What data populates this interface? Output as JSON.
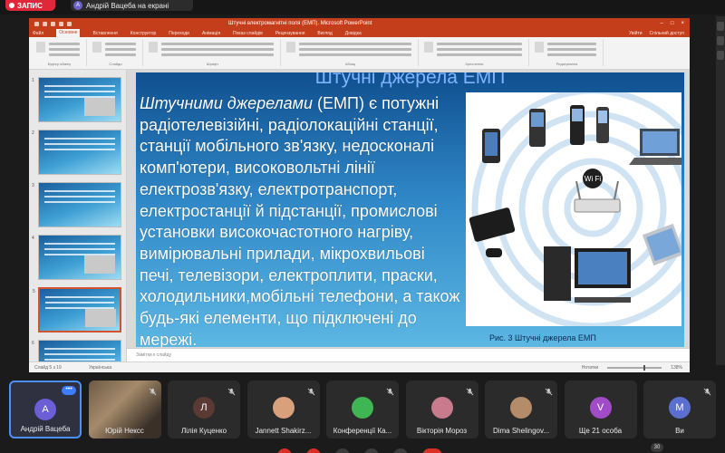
{
  "topbar": {
    "record_label": "ЗАПИС",
    "presenter_initial": "А",
    "presenter_text": "Андрій Вацеба на екрані"
  },
  "ppt": {
    "window_title": "Штучні електромагнітні поля (ЕМП). Microsoft PowerPoint",
    "tabs": [
      "Файл",
      "Основне",
      "Вставлення",
      "Конструктор",
      "Переходи",
      "Анімація",
      "Показ слайдів",
      "Рецензування",
      "Вигляд",
      "Довідка"
    ],
    "active_tab_index": 1,
    "account": "Увійти",
    "share": "Спільний доступ",
    "ribbon_groups": [
      "Буфер обміну",
      "Слайди",
      "Шрифт",
      "Абзац",
      "Креслення",
      "Редагування"
    ],
    "slide_count_text": "Слайд 5 з 19",
    "language": "Українська",
    "notes_button": "Нотатки",
    "zoom": "138%",
    "notes_placeholder": "Замітки к слайду",
    "thumbnail_numbers": [
      "1",
      "2",
      "3",
      "4",
      "5",
      "6"
    ],
    "selected_thumbnail": 4
  },
  "slide": {
    "title": "Штучні джерела ЕМП",
    "lead_italic": "Штучними джерелами",
    "body": " (ЕМП) є потужні радіотелевізійні, радіолокаційні станції, станції мобільного зв'язку, недосконалі комп'ютери, високовольтні лінії електрозв'язку, електротранспорт, електростанції й підстанції, промислові установки високочастотного нагріву, вимірювальні прилади, мікрохвильові печі, телевізори, електроплити, праски, холодильники,мобільні телефони, а також будь-які елементи, що підключені до мережі.",
    "wifi_label": "Wi Fi",
    "caption": "Рис. 3 Штучні джерела ЕМП"
  },
  "participants": [
    {
      "name": "Андрій Вацеба",
      "initial": "А",
      "color": "#6b5ed6",
      "active": true,
      "type": "avatar"
    },
    {
      "name": "Юрій Нексс",
      "initial": "",
      "color": "#6d5a45",
      "active": false,
      "type": "video"
    },
    {
      "name": "Лілія Куценко",
      "initial": "Л",
      "color": "#5a3a33",
      "active": false,
      "type": "avatar"
    },
    {
      "name": "Jannett Shakirz...",
      "initial": "",
      "color": "#d9a07c",
      "active": false,
      "type": "photo"
    },
    {
      "name": "Конференції Ка...",
      "initial": "",
      "color": "#3fb553",
      "active": false,
      "type": "logo"
    },
    {
      "name": "Вікторія Мороз",
      "initial": "",
      "color": "#c77b8c",
      "active": false,
      "type": "photo"
    },
    {
      "name": "Dima Shelingov...",
      "initial": "",
      "color": "#b48c6a",
      "active": false,
      "type": "photo"
    },
    {
      "name": "Ще 21 особа",
      "initial": "V",
      "color": "#a04cc9",
      "active": false,
      "type": "group"
    },
    {
      "name": "Ви",
      "initial": "M",
      "color": "#5a6fd0",
      "active": false,
      "type": "avatar"
    }
  ],
  "bottom": {
    "count": "30"
  },
  "colors": {
    "ppt_accent": "#c43e1c",
    "record": "#e0283a",
    "active_tile_border": "#4a90ff"
  }
}
